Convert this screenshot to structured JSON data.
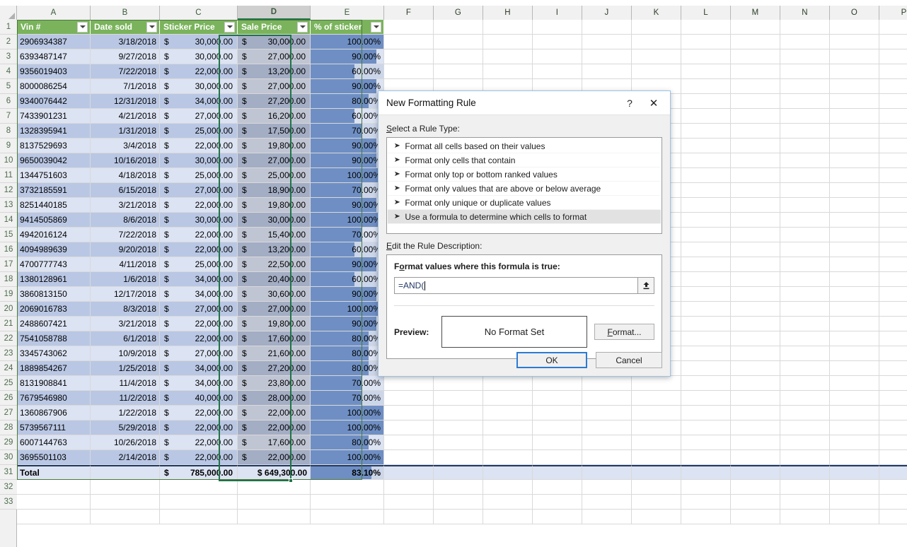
{
  "spreadsheet": {
    "column_headers": [
      "A",
      "B",
      "C",
      "D",
      "E",
      "F",
      "G",
      "H",
      "I",
      "J",
      "K",
      "L",
      "M",
      "N",
      "O",
      "P"
    ],
    "selected_column": "D",
    "table_columns": [
      "A",
      "B",
      "C",
      "D",
      "E"
    ],
    "row_numbers": [
      "1",
      "2",
      "3",
      "4",
      "5",
      "6",
      "7",
      "8",
      "9",
      "10",
      "11",
      "12",
      "13",
      "14",
      "15",
      "16",
      "17",
      "18",
      "19",
      "20",
      "21",
      "22",
      "23",
      "24",
      "25",
      "26",
      "27",
      "28",
      "29",
      "30",
      "31",
      "32",
      "33"
    ],
    "table_headers": [
      "Vin #",
      "Date sold",
      "Sticker Price",
      "Sale Price",
      "% of sticker"
    ],
    "rows": [
      {
        "row": "2",
        "vin": "2906934387",
        "date": "3/18/2018",
        "sticker": "30,000.00",
        "sale": "30,000.00",
        "pct": "100.00%",
        "pct_val": 100
      },
      {
        "row": "3",
        "vin": "6393487147",
        "date": "9/27/2018",
        "sticker": "30,000.00",
        "sale": "27,000.00",
        "pct": "90.00%",
        "pct_val": 90
      },
      {
        "row": "4",
        "vin": "9356019403",
        "date": "7/22/2018",
        "sticker": "22,000.00",
        "sale": "13,200.00",
        "pct": "60.00%",
        "pct_val": 60
      },
      {
        "row": "5",
        "vin": "8000086254",
        "date": "7/1/2018",
        "sticker": "30,000.00",
        "sale": "27,000.00",
        "pct": "90.00%",
        "pct_val": 90
      },
      {
        "row": "6",
        "vin": "9340076442",
        "date": "12/31/2018",
        "sticker": "34,000.00",
        "sale": "27,200.00",
        "pct": "80.00%",
        "pct_val": 80
      },
      {
        "row": "7",
        "vin": "7433901231",
        "date": "4/21/2018",
        "sticker": "27,000.00",
        "sale": "16,200.00",
        "pct": "60.00%",
        "pct_val": 60
      },
      {
        "row": "8",
        "vin": "1328395941",
        "date": "1/31/2018",
        "sticker": "25,000.00",
        "sale": "17,500.00",
        "pct": "70.00%",
        "pct_val": 70
      },
      {
        "row": "9",
        "vin": "8137529693",
        "date": "3/4/2018",
        "sticker": "22,000.00",
        "sale": "19,800.00",
        "pct": "90.00%",
        "pct_val": 90
      },
      {
        "row": "10",
        "vin": "9650039042",
        "date": "10/16/2018",
        "sticker": "30,000.00",
        "sale": "27,000.00",
        "pct": "90.00%",
        "pct_val": 90
      },
      {
        "row": "11",
        "vin": "1344751603",
        "date": "4/18/2018",
        "sticker": "25,000.00",
        "sale": "25,000.00",
        "pct": "100.00%",
        "pct_val": 100
      },
      {
        "row": "12",
        "vin": "3732185591",
        "date": "6/15/2018",
        "sticker": "27,000.00",
        "sale": "18,900.00",
        "pct": "70.00%",
        "pct_val": 70
      },
      {
        "row": "13",
        "vin": "8251440185",
        "date": "3/21/2018",
        "sticker": "22,000.00",
        "sale": "19,800.00",
        "pct": "90.00%",
        "pct_val": 90
      },
      {
        "row": "14",
        "vin": "9414505869",
        "date": "8/6/2018",
        "sticker": "30,000.00",
        "sale": "30,000.00",
        "pct": "100.00%",
        "pct_val": 100
      },
      {
        "row": "15",
        "vin": "4942016124",
        "date": "7/22/2018",
        "sticker": "22,000.00",
        "sale": "15,400.00",
        "pct": "70.00%",
        "pct_val": 70
      },
      {
        "row": "16",
        "vin": "4094989639",
        "date": "9/20/2018",
        "sticker": "22,000.00",
        "sale": "13,200.00",
        "pct": "60.00%",
        "pct_val": 60
      },
      {
        "row": "17",
        "vin": "4700777743",
        "date": "4/11/2018",
        "sticker": "25,000.00",
        "sale": "22,500.00",
        "pct": "90.00%",
        "pct_val": 90
      },
      {
        "row": "18",
        "vin": "1380128961",
        "date": "1/6/2018",
        "sticker": "34,000.00",
        "sale": "20,400.00",
        "pct": "60.00%",
        "pct_val": 60
      },
      {
        "row": "19",
        "vin": "3860813150",
        "date": "12/17/2018",
        "sticker": "34,000.00",
        "sale": "30,600.00",
        "pct": "90.00%",
        "pct_val": 90
      },
      {
        "row": "20",
        "vin": "2069016783",
        "date": "8/3/2018",
        "sticker": "27,000.00",
        "sale": "27,000.00",
        "pct": "100.00%",
        "pct_val": 100
      },
      {
        "row": "21",
        "vin": "2488607421",
        "date": "3/21/2018",
        "sticker": "22,000.00",
        "sale": "19,800.00",
        "pct": "90.00%",
        "pct_val": 90
      },
      {
        "row": "22",
        "vin": "7541058788",
        "date": "6/1/2018",
        "sticker": "22,000.00",
        "sale": "17,600.00",
        "pct": "80.00%",
        "pct_val": 80
      },
      {
        "row": "23",
        "vin": "3345743062",
        "date": "10/9/2018",
        "sticker": "27,000.00",
        "sale": "21,600.00",
        "pct": "80.00%",
        "pct_val": 80
      },
      {
        "row": "24",
        "vin": "1889854267",
        "date": "1/25/2018",
        "sticker": "34,000.00",
        "sale": "27,200.00",
        "pct": "80.00%",
        "pct_val": 80
      },
      {
        "row": "25",
        "vin": "8131908841",
        "date": "11/4/2018",
        "sticker": "34,000.00",
        "sale": "23,800.00",
        "pct": "70.00%",
        "pct_val": 70
      },
      {
        "row": "26",
        "vin": "7679546980",
        "date": "11/2/2018",
        "sticker": "40,000.00",
        "sale": "28,000.00",
        "pct": "70.00%",
        "pct_val": 70
      },
      {
        "row": "27",
        "vin": "1360867906",
        "date": "1/22/2018",
        "sticker": "22,000.00",
        "sale": "22,000.00",
        "pct": "100.00%",
        "pct_val": 100
      },
      {
        "row": "28",
        "vin": "5739567111",
        "date": "5/29/2018",
        "sticker": "22,000.00",
        "sale": "22,000.00",
        "pct": "100.00%",
        "pct_val": 100
      },
      {
        "row": "29",
        "vin": "6007144763",
        "date": "10/26/2018",
        "sticker": "22,000.00",
        "sale": "17,600.00",
        "pct": "80.00%",
        "pct_val": 80
      },
      {
        "row": "30",
        "vin": "3695501103",
        "date": "2/14/2018",
        "sticker": "22,000.00",
        "sale": "22,000.00",
        "pct": "100.00%",
        "pct_val": 100
      }
    ],
    "total_row": {
      "row": "31",
      "label": "Total",
      "sticker": "785,000.00",
      "sale": "$ 649,300.00",
      "pct": "83.10%",
      "pct_val": 83.1,
      "currency_symbol": "$"
    },
    "currency_symbol": "$",
    "empty_row_numbers": [
      "32",
      "33"
    ]
  },
  "dialog": {
    "title": "New Formatting Rule",
    "help_icon": "?",
    "close_icon": "✕",
    "rule_type_label": "Select a Rule Type:",
    "rule_types": [
      "Format all cells based on their values",
      "Format only cells that contain",
      "Format only top or bottom ranked values",
      "Format only values that are above or below average",
      "Format only unique or duplicate values",
      "Use a formula to determine which cells to format"
    ],
    "selected_rule_index": 5,
    "bullet_glyph": "➤",
    "edit_description_label": "Edit the Rule Description:",
    "formula_prompt": "Format values where this formula is true:",
    "formula_value": "=AND(",
    "collapse_icon": "⬆",
    "preview_label": "Preview:",
    "preview_text": "No Format Set",
    "format_button": "Format...",
    "ok_button": "OK",
    "cancel_button": "Cancel"
  },
  "colors": {
    "table_header_green": "#7ab35c",
    "selection_green": "#217346",
    "band_dark": "#b9c7e4",
    "band_light": "#dce3f3",
    "data_bar": "#6f8fc4",
    "ok_focus_blue": "#2b7bd4"
  }
}
